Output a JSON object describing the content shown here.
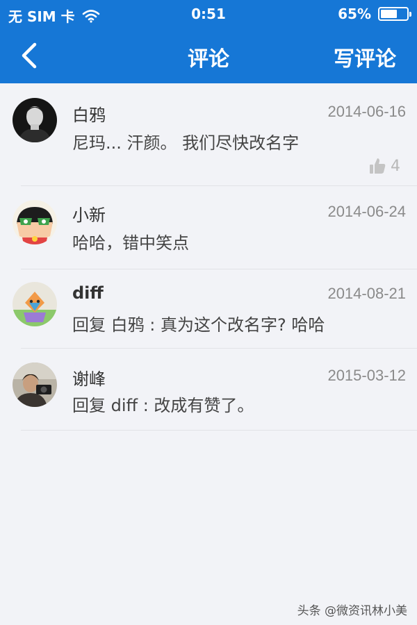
{
  "status_bar": {
    "carrier": "无 SIM 卡",
    "time": "0:51",
    "battery": "65%",
    "battery_level": 0.65
  },
  "nav": {
    "title": "评论",
    "write_label": "写评论"
  },
  "comments": [
    {
      "name": "白鸦",
      "date": "2014-06-16",
      "text": "尼玛... 汗颜。 我们尽快改名字",
      "likes": "4"
    },
    {
      "name": "小新",
      "date": "2014-06-24",
      "text": "哈哈，错中笑点"
    },
    {
      "name": "diff",
      "date": "2014-08-21",
      "text": "回复 白鸦 :  真为这个改名字? 哈哈"
    },
    {
      "name": "谢峰",
      "date": "2015-03-12",
      "text": "回复 diff :  改成有赞了。"
    }
  ],
  "watermark": "头条 @微资讯林小美",
  "colors": {
    "accent": "#1677d6",
    "background": "#f2f3f7"
  }
}
